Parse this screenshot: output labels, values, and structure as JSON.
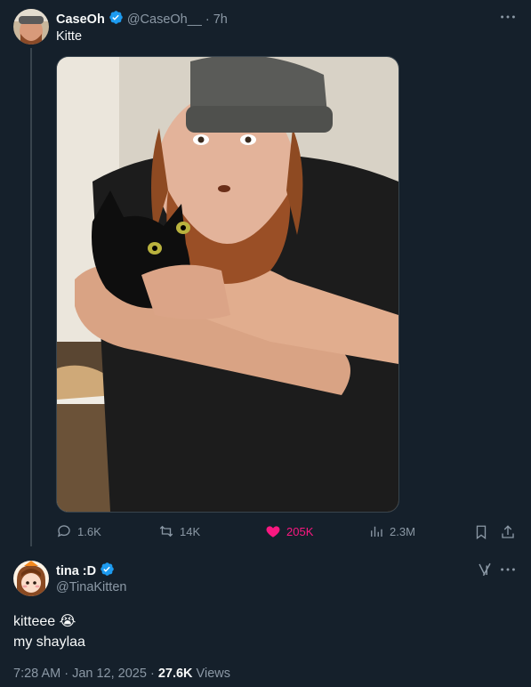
{
  "tweet": {
    "author_name": "CaseOh",
    "handle": "@CaseOh__",
    "time": "· 7h",
    "text": "Kitte",
    "image_alt": "Bearded man in grey beanie holding a black cat",
    "stats": {
      "replies": "1.6K",
      "retweets": "14K",
      "likes": "205K",
      "views": "2.3M"
    }
  },
  "reply": {
    "author_name": "tina :D",
    "handle": "@TinaKitten",
    "line1": "kitteee 😭",
    "line2": "my shaylaa",
    "timestamp": "7:28 AM · Jan 12, 2025 · ",
    "views_count": "27.6K",
    "views_label": " Views"
  },
  "colors": {
    "background": "#15202b",
    "muted": "#8b98a5",
    "like": "#f91880",
    "verified": "#1d9bf0"
  }
}
